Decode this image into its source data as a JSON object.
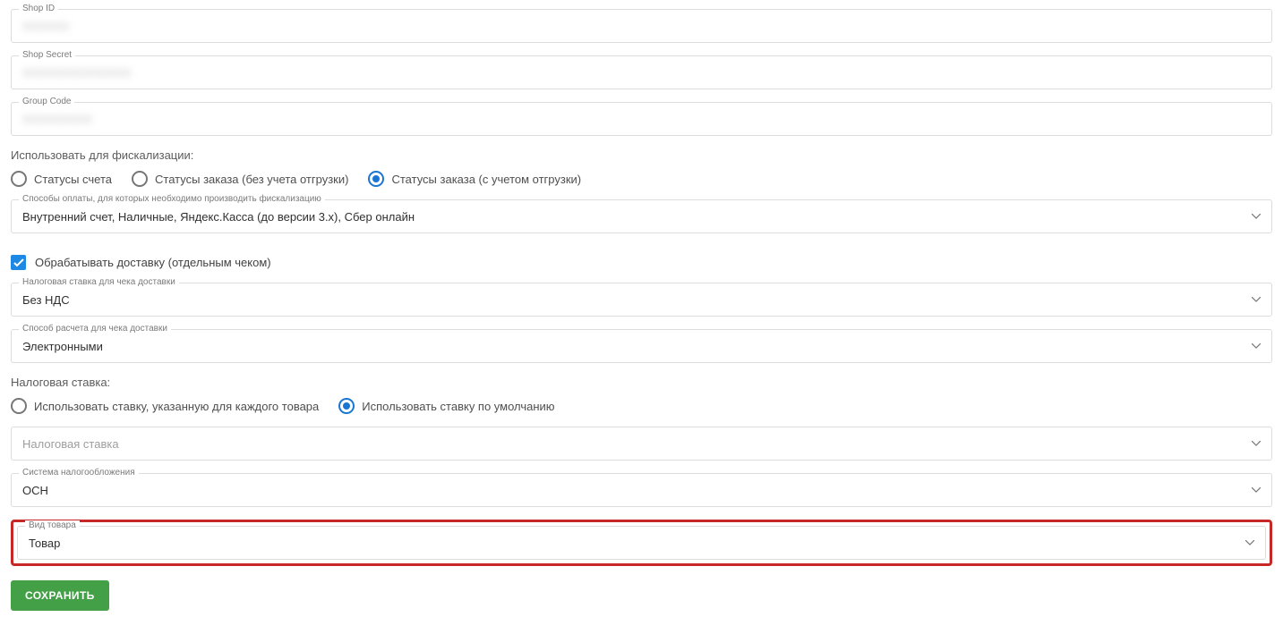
{
  "shopId": {
    "label": "Shop ID",
    "value": "XXXXXX"
  },
  "shopSecret": {
    "label": "Shop Secret",
    "value": "XXXXXXXXXXXXXX"
  },
  "groupCode": {
    "label": "Group Code",
    "value": "XXXXXXXXX"
  },
  "fiscalSection": {
    "label": "Использовать для фискализации:",
    "options": [
      {
        "label": "Статусы счета",
        "checked": false
      },
      {
        "label": "Статусы заказа (без учета отгрузки)",
        "checked": false
      },
      {
        "label": "Статусы заказа (с учетом отгрузки)",
        "checked": true
      }
    ]
  },
  "paymentMethods": {
    "label": "Способы оплаты, для которых необходимо производить фискализацию",
    "value": "Внутренний счет, Наличные, Яндекс.Касса (до версии 3.x), Сбер онлайн"
  },
  "processDelivery": {
    "label": "Обрабатывать доставку (отдельным чеком)",
    "checked": true
  },
  "deliveryTaxRate": {
    "label": "Налоговая ставка для чека доставки",
    "value": "Без НДС"
  },
  "deliveryPayMethod": {
    "label": "Способ расчета для чека доставки",
    "value": "Электронными"
  },
  "taxRateSection": {
    "label": "Налоговая ставка:",
    "options": [
      {
        "label": "Использовать ставку, указанную для каждого товара",
        "checked": false
      },
      {
        "label": "Использовать ставку по умолчанию",
        "checked": true
      }
    ]
  },
  "taxRateSelect": {
    "label": "",
    "placeholder": "Налоговая ставка"
  },
  "taxSystem": {
    "label": "Система налогообложения",
    "value": "ОСН"
  },
  "productType": {
    "label": "Вид товара",
    "value": "Товар"
  },
  "saveButton": "Сохранить"
}
